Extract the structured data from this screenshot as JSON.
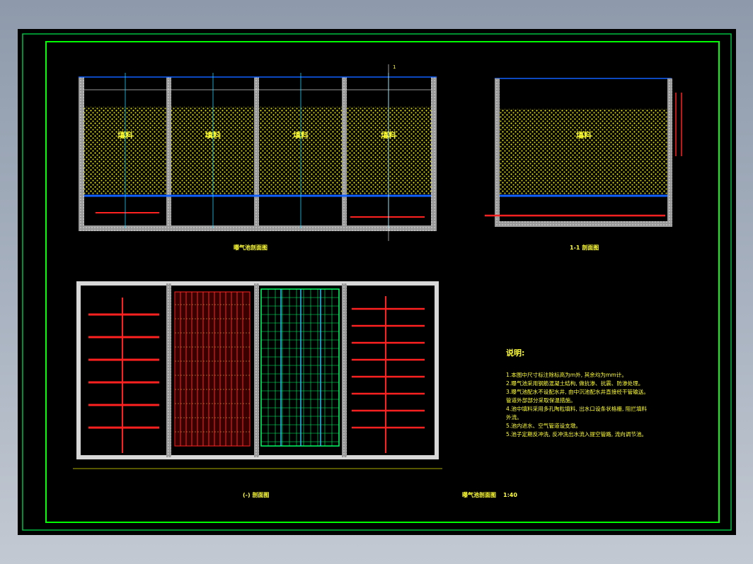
{
  "sheet": {
    "colors": {
      "background": "#000000",
      "frame": "#00ff00",
      "wall": "#d8d8d8",
      "media": "#e6e600",
      "water_line": "#1060ff",
      "pipe": "#ff2020",
      "grid": "#00ff66",
      "text": "#ffff33"
    }
  },
  "section_view": {
    "cells": [
      {
        "label": "填料"
      },
      {
        "label": "填料"
      },
      {
        "label": "填料"
      },
      {
        "label": "填料"
      }
    ],
    "cut_mark": "1",
    "title": "曝气池剖面图"
  },
  "side_section": {
    "cell_label": "填料",
    "title": "1-1 剖面图"
  },
  "plan_view": {
    "title": "(-) 剖面图",
    "cells": [
      {
        "style": "branch-pipes"
      },
      {
        "style": "dense-red-grid"
      },
      {
        "style": "green-grid"
      },
      {
        "style": "branch-pipes"
      }
    ]
  },
  "notes": {
    "heading": "说明:",
    "items": [
      "1.本图中尺寸标注除标高为m外, 其余均为mm计。",
      "2.曝气池采用钢筋混凝土结构, 做抗渗、抗震、防渗处理。",
      "3.曝气池配水不设配水井, 由中沉池配水井直接经干管输送。",
      "管道外部部分采取保温措施。",
      "4.池中填料采用多孔陶粒填料, 出水口设条状格栅, 阻拦填料",
      "外流。",
      "5.池内进水、空气管道设支墩。",
      "5.池子定期反冲洗, 反冲洗出水流入提空管路, 流向调节池。"
    ]
  },
  "drawing_caption": {
    "title": "曝气池剖面图",
    "scale": "1:40"
  }
}
